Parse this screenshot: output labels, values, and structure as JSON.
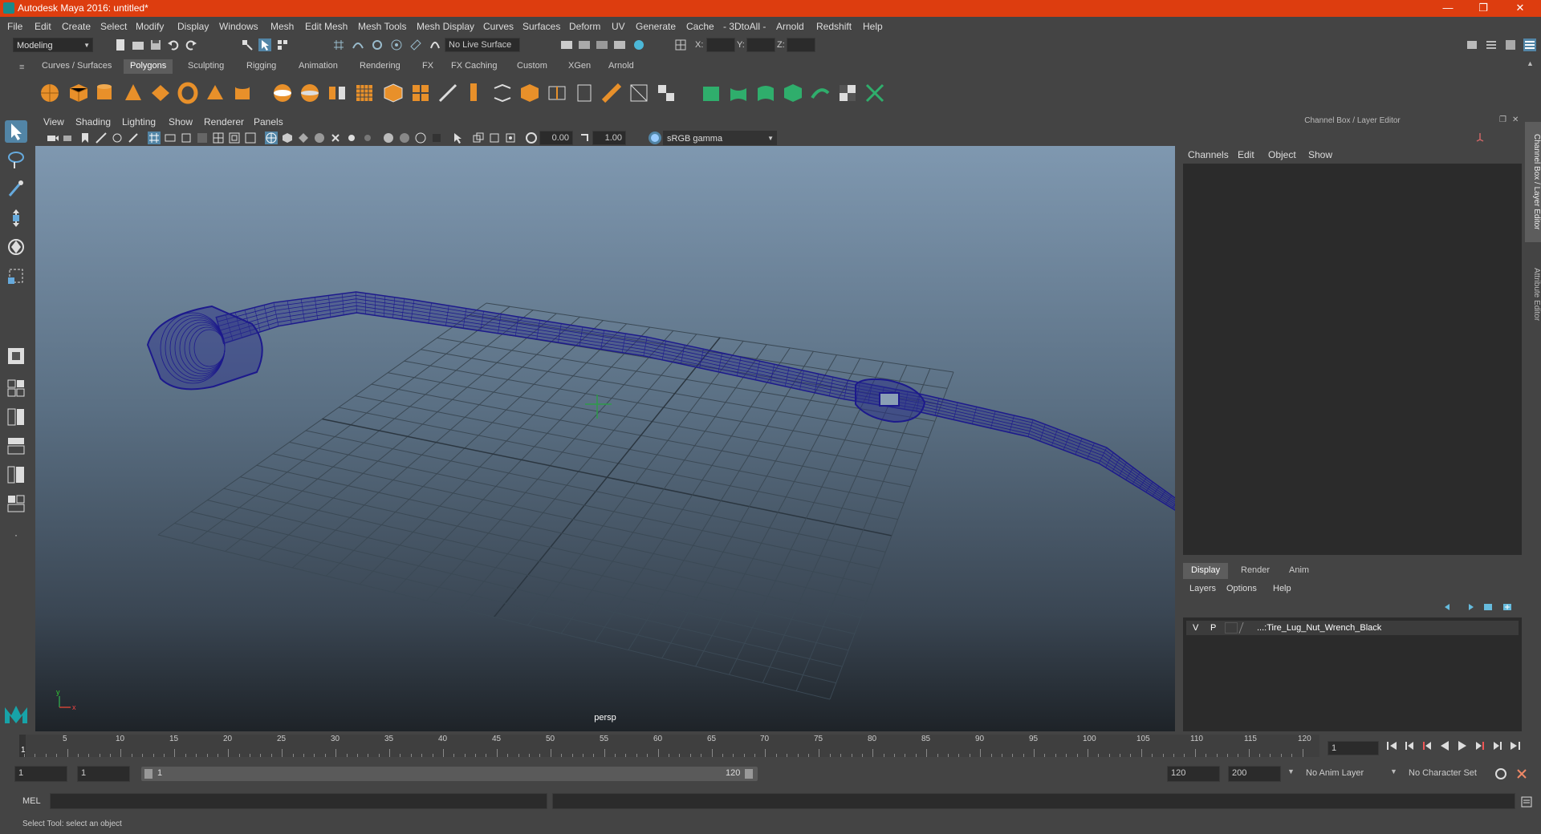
{
  "window": {
    "title": "Autodesk Maya 2016: untitled*",
    "minimize": "—",
    "restore": "❐",
    "close": "✕"
  },
  "menubar": [
    "File",
    "Edit",
    "Create",
    "Select",
    "Modify",
    "Display",
    "Windows",
    "Mesh",
    "Edit Mesh",
    "Mesh Tools",
    "Mesh Display",
    "Curves",
    "Surfaces",
    "Deform",
    "UV",
    "Generate",
    "Cache",
    "- 3DtoAll -",
    "Arnold",
    "Redshift",
    "Help"
  ],
  "statusline": {
    "menuset": "Modeling",
    "live_surface": "No Live Surface",
    "x_label": "X:",
    "y_label": "Y:",
    "z_label": "Z:"
  },
  "shelf_tabs": [
    "Curves / Surfaces",
    "Polygons",
    "Sculpting",
    "Rigging",
    "Animation",
    "Rendering",
    "FX",
    "FX Caching",
    "Custom",
    "XGen",
    "Arnold"
  ],
  "shelf_active": "Polygons",
  "viewport": {
    "menu": [
      "View",
      "Shading",
      "Lighting",
      "Show",
      "Renderer",
      "Panels"
    ],
    "exposure": "0.00",
    "gamma": "1.00",
    "colorspace": "sRGB gamma",
    "camera_label": "persp",
    "axis_x": "x",
    "axis_y": "y"
  },
  "channelbox": {
    "title": "Channel Box / Layer Editor",
    "menu": [
      "Channels",
      "Edit",
      "Object",
      "Show"
    ],
    "layer_tabs": [
      "Display",
      "Render",
      "Anim"
    ],
    "layer_active": "Display",
    "layer_menu": [
      "Layers",
      "Options",
      "Help"
    ],
    "layer": {
      "v": "V",
      "p": "P",
      "name": "...:Tire_Lug_Nut_Wrench_Black"
    },
    "side_tabs": [
      "Channel Box / Layer Editor",
      "Attribute Editor"
    ]
  },
  "timeline": {
    "ticks": [
      "5",
      "10",
      "15",
      "20",
      "25",
      "30",
      "35",
      "40",
      "45",
      "50",
      "55",
      "60",
      "65",
      "70",
      "75",
      "80",
      "85",
      "90",
      "95",
      "100",
      "105",
      "110",
      "115",
      "120"
    ],
    "current_frame_label": "1",
    "current_frame": "1"
  },
  "range": {
    "start": "1",
    "start_inner": "1",
    "slider_start": "1",
    "slider_end": "120",
    "end_inner": "120",
    "end": "200",
    "anim_layer": "No Anim Layer",
    "character_set": "No Character Set"
  },
  "mel": {
    "label": "MEL"
  },
  "helpline": {
    "text": "Select Tool: select an object"
  }
}
